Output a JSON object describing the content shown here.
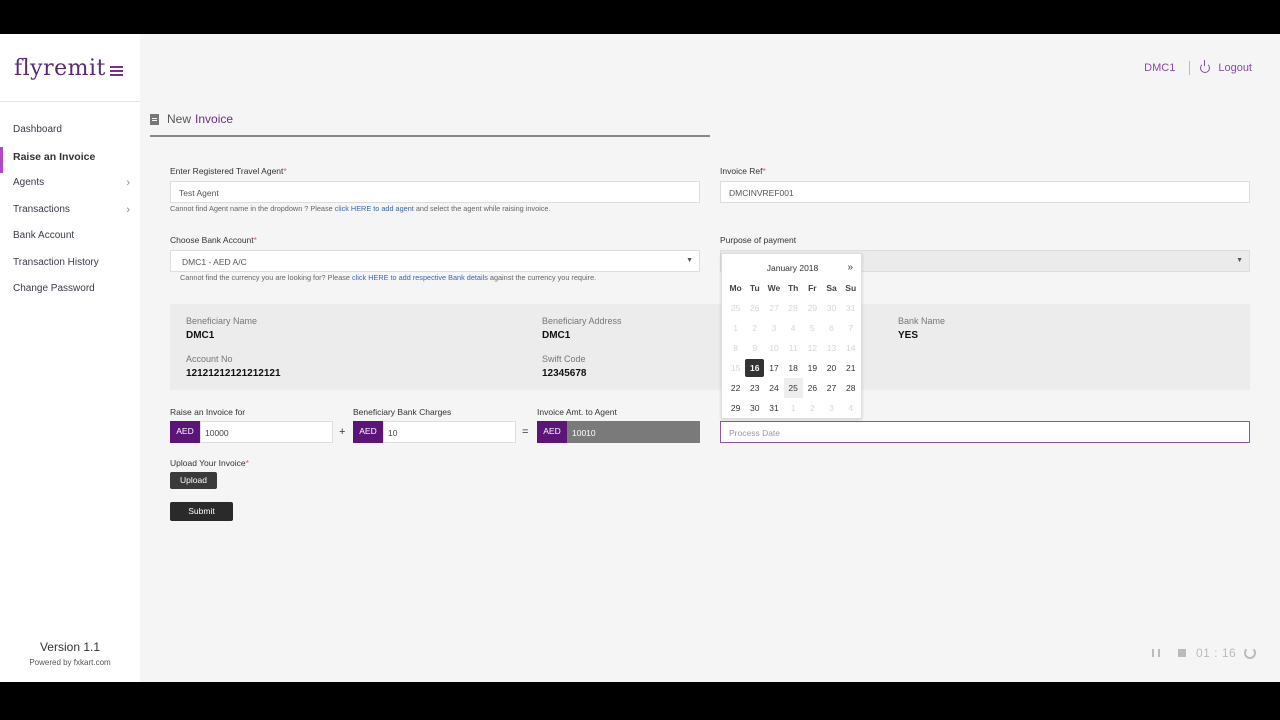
{
  "brand": {
    "logo": "flyremit"
  },
  "sidebar": {
    "items": [
      {
        "label": "Dashboard"
      },
      {
        "label": "Raise an Invoice"
      },
      {
        "label": "Agents",
        "chevron": "›"
      },
      {
        "label": "Transactions",
        "chevron": "›"
      },
      {
        "label": "Bank Account"
      },
      {
        "label": "Transaction History"
      },
      {
        "label": "Change Password"
      }
    ],
    "version": "Version 1.1",
    "powered_by": "Powered by fxkart.com"
  },
  "topbar": {
    "user": "DMC1",
    "logout": "Logout"
  },
  "page": {
    "title_prefix": "New",
    "title_accent": "Invoice"
  },
  "form": {
    "agent": {
      "label": "Enter Registered Travel Agent",
      "value": "Test Agent",
      "hint_pre": "Cannot find Agent name in the dropdown ? Please ",
      "hint_link": "click HERE to add agent",
      "hint_post": " and select the agent while raising invoice."
    },
    "invoice_ref": {
      "label": "Invoice Ref",
      "value": "DMCINVREF001"
    },
    "bank_account": {
      "label": "Choose Bank Account",
      "value": "DMC1 - AED A/C",
      "hint_pre": "Cannot find the currency you are looking for? Please ",
      "hint_link": "click HERE to add respective Bank details",
      "hint_post": " against the currency you require."
    },
    "purpose": {
      "label": "Purpose of payment"
    },
    "beneficiary": {
      "name_label": "Beneficiary Name",
      "name": "DMC1",
      "address_label": "Beneficiary Address",
      "address": "DMC1",
      "bank_label": "Bank Name",
      "bank": "YES",
      "account_label": "Account No",
      "account": "12121212121212121",
      "swift_label": "Swift Code",
      "swift": "12345678"
    },
    "raise_for": {
      "label": "Raise an Invoice for",
      "currency": "AED",
      "value": "10000"
    },
    "bank_charges": {
      "label": "Beneficiary Bank Charges",
      "currency": "AED",
      "value": "10"
    },
    "amount_to_agent": {
      "label": "Invoice Amt. to Agent",
      "currency": "AED",
      "value": "10010"
    },
    "plus": "+",
    "equals": "=",
    "upload": {
      "label": "Upload Your Invoice",
      "button": "Upload"
    },
    "submit": "Submit",
    "process_date": {
      "placeholder": "Process Date"
    }
  },
  "calendar": {
    "title": "January 2018",
    "next": "»",
    "weekdays": [
      "Mo",
      "Tu",
      "We",
      "Th",
      "Fr",
      "Sa",
      "Su"
    ],
    "weeks": [
      [
        "25",
        "26",
        "27",
        "28",
        "29",
        "30",
        "31"
      ],
      [
        "1",
        "2",
        "3",
        "4",
        "5",
        "6",
        "7"
      ],
      [
        "8",
        "9",
        "10",
        "11",
        "12",
        "13",
        "14"
      ],
      [
        "15",
        "16",
        "17",
        "18",
        "19",
        "20",
        "21"
      ],
      [
        "22",
        "23",
        "24",
        "25",
        "26",
        "27",
        "28"
      ],
      [
        "29",
        "30",
        "31",
        "1",
        "2",
        "3",
        "4"
      ]
    ],
    "selected": "16"
  },
  "player": {
    "time": "01 : 16"
  }
}
